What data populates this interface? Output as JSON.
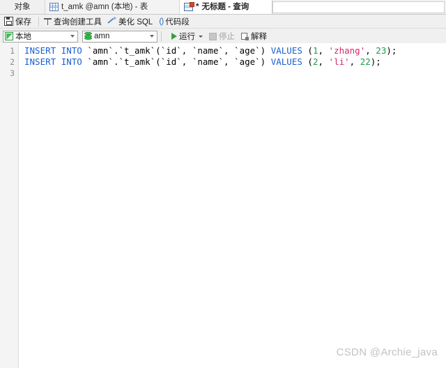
{
  "window": {
    "app": "Navicat SQL Editor"
  },
  "tabs": [
    {
      "label": "对象",
      "icon": "none",
      "active": false,
      "type": "plain"
    },
    {
      "label": "t_amk @amn (本地) - 表",
      "icon": "table-grid-icon",
      "active": false,
      "type": "doc"
    },
    {
      "label": "无标题 - 查询",
      "prefix": "*",
      "icon": "query-icon",
      "active": true,
      "type": "doc"
    }
  ],
  "toolbar": {
    "save_label": "保存",
    "query_builder_label": "查询创建工具",
    "beautify_label": "美化 SQL",
    "snippet_label": "代码段",
    "snippet_icon_text": "()"
  },
  "controls": {
    "connection": {
      "value": "本地",
      "icon": "connection-icon"
    },
    "database": {
      "value": "amn",
      "icon": "database-icon"
    },
    "run_label": "运行",
    "stop_label": "停止",
    "explain_label": "解释"
  },
  "editor": {
    "gutter_numbers": [
      "1",
      "2",
      "3"
    ],
    "lines": [
      [
        {
          "t": "INSERT",
          "c": "kw"
        },
        {
          "t": " ",
          "c": "pun"
        },
        {
          "t": "INTO",
          "c": "kw"
        },
        {
          "t": " `amn`.`t_amk`(`id`, `name`, `age`) ",
          "c": "id"
        },
        {
          "t": "VALUES",
          "c": "kw"
        },
        {
          "t": " (",
          "c": "pun"
        },
        {
          "t": "1",
          "c": "num"
        },
        {
          "t": ", ",
          "c": "pun"
        },
        {
          "t": "'zhang'",
          "c": "str"
        },
        {
          "t": ", ",
          "c": "pun"
        },
        {
          "t": "23",
          "c": "num"
        },
        {
          "t": ");",
          "c": "pun"
        }
      ],
      [
        {
          "t": "INSERT",
          "c": "kw"
        },
        {
          "t": " ",
          "c": "pun"
        },
        {
          "t": "INTO",
          "c": "kw"
        },
        {
          "t": " `amn`.`t_amk`(`id`, `name`, `age`) ",
          "c": "id"
        },
        {
          "t": "VALUES",
          "c": "kw"
        },
        {
          "t": " (",
          "c": "pun"
        },
        {
          "t": "2",
          "c": "num"
        },
        {
          "t": ", ",
          "c": "pun"
        },
        {
          "t": "'li'",
          "c": "str"
        },
        {
          "t": ", ",
          "c": "pun"
        },
        {
          "t": "22",
          "c": "num"
        },
        {
          "t": ");",
          "c": "pun"
        }
      ],
      []
    ]
  },
  "watermark": "CSDN @Archie_java",
  "colors": {
    "keyword": "#1a5fd0",
    "string": "#d6276a",
    "number": "#1d9a47",
    "accent_green": "#3fbf52",
    "toolbar_bg": "#f0f0f0",
    "gutter_bg": "#f4f4f4"
  }
}
